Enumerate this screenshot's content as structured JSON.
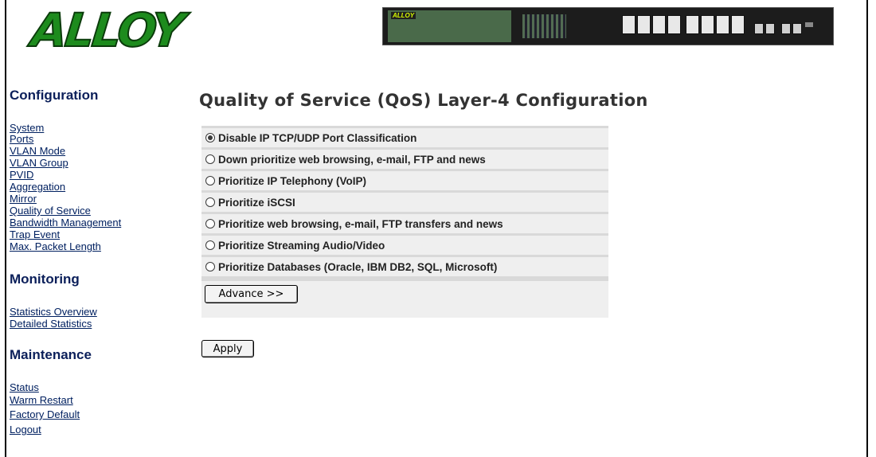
{
  "logo": {
    "text": "ALLOY"
  },
  "switch_image": {
    "brand": "ALLOY",
    "port_count": 16
  },
  "sidebar": {
    "sections": [
      {
        "title": "Configuration",
        "items": [
          "System",
          "Ports",
          "VLAN Mode",
          "VLAN Group",
          "PVID",
          "Aggregation",
          "Mirror",
          "Quality of Service",
          "Bandwidth Management",
          "Trap Event",
          "Max. Packet Length"
        ]
      },
      {
        "title": "Monitoring",
        "items": [
          "Statistics Overview",
          "Detailed Statistics"
        ]
      },
      {
        "title": "Maintenance",
        "items": [
          "Status",
          "Warm Restart",
          "Factory Default",
          "Logout"
        ]
      }
    ]
  },
  "main": {
    "title": "Quality of Service (QoS) Layer-4 Configuration",
    "options": [
      {
        "label": "Disable IP TCP/UDP Port Classification",
        "checked": true
      },
      {
        "label": "Down prioritize web browsing, e-mail, FTP and news",
        "checked": false
      },
      {
        "label": "Prioritize IP Telephony (VoIP)",
        "checked": false
      },
      {
        "label": "Prioritize iSCSI",
        "checked": false
      },
      {
        "label": "Prioritize web browsing, e-mail, FTP transfers and news",
        "checked": false
      },
      {
        "label": "Prioritize Streaming Audio/Video",
        "checked": false
      },
      {
        "label": "Prioritize Databases (Oracle, IBM DB2, SQL, Microsoft)",
        "checked": false
      }
    ],
    "advance_label": "Advance >>",
    "apply_label": "Apply"
  },
  "colors": {
    "link": "#002060",
    "section_title": "#0b1f5a",
    "panel_bg": "#d9d9d9",
    "row_bg": "#efefef",
    "logo_green": "#1d8b1d"
  }
}
